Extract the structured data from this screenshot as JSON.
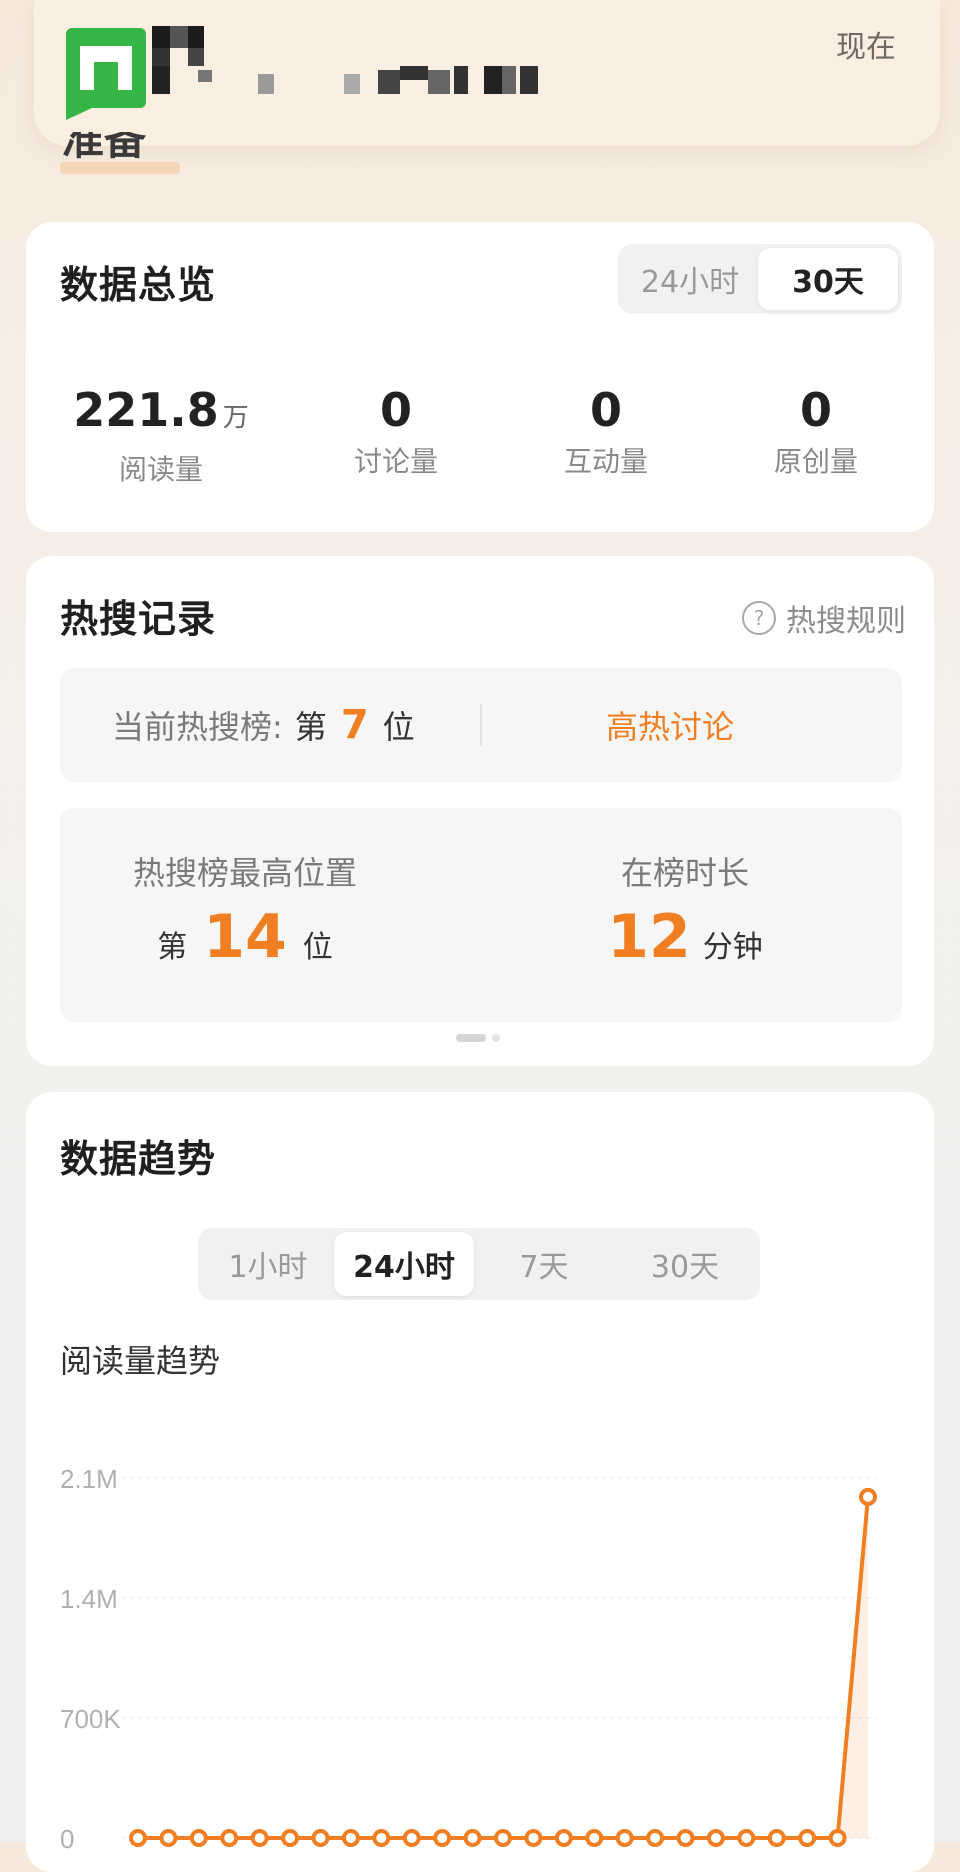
{
  "notification": {
    "time": "现在",
    "icon": "green-app-icon",
    "title_obscured": true
  },
  "page_behind_title": "准备",
  "overview": {
    "title": "数据总览",
    "tabs": [
      "24小时",
      "30天"
    ],
    "active_tab": "30天",
    "stats": [
      {
        "value": "221.8",
        "unit": "万",
        "label": "阅读量"
      },
      {
        "value": "0",
        "unit": "",
        "label": "讨论量"
      },
      {
        "value": "0",
        "unit": "",
        "label": "互动量"
      },
      {
        "value": "0",
        "unit": "",
        "label": "原创量"
      }
    ]
  },
  "hot_search": {
    "title": "热搜记录",
    "rules_label": "热搜规则",
    "current_prefix": "当前热搜榜:",
    "current_di": "第",
    "current_rank": "7",
    "current_wei": "位",
    "current_tag": "高热讨论",
    "highest_label": "热搜榜最高位置",
    "highest_di": "第",
    "highest_rank": "14",
    "highest_wei": "位",
    "duration_label": "在榜时长",
    "duration_value": "12",
    "duration_unit": "分钟"
  },
  "trend": {
    "title": "数据趋势",
    "tabs": [
      "1小时",
      "24小时",
      "7天",
      "30天"
    ],
    "active_tab": "24小时",
    "chart_title": "阅读量趋势"
  },
  "chart_data": {
    "type": "line",
    "title": "阅读量趋势",
    "ytick_labels": [
      "0",
      "700K",
      "1.4M",
      "2.1M"
    ],
    "yticks": [
      0,
      700000,
      1400000,
      2100000
    ],
    "ylim": [
      0,
      2100000
    ],
    "series": [
      {
        "values": [
          0,
          0,
          0,
          0,
          0,
          0,
          0,
          0,
          0,
          0,
          0,
          0,
          0,
          0,
          0,
          0,
          0,
          0,
          0,
          0,
          0,
          0,
          0,
          0,
          1990000
        ]
      }
    ],
    "grid": true,
    "colors": {
      "line": "#f07f23"
    }
  },
  "colors": {
    "accent": "#f07f23",
    "app_icon_green": "#35b548"
  }
}
